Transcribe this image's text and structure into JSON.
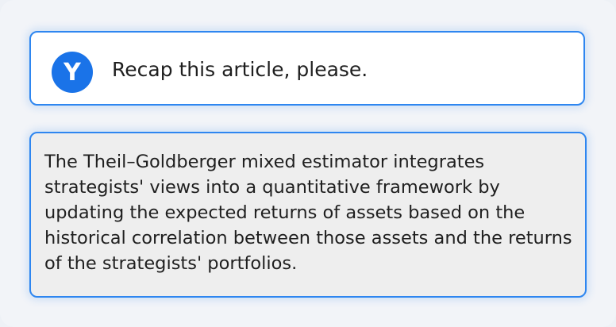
{
  "user_message": {
    "avatar_letter": "Y",
    "text": "Recap this article, please."
  },
  "assistant_message": {
    "text": "The Theil–Goldberger mixed estimator integrates strategists' views into a quantitative framework by updating the expected returns of assets based on the historical correlation between those assets and the returns of the strategists' portfolios."
  },
  "colors": {
    "accent": "#2e86f0",
    "avatar_bg": "#1a73e8",
    "reply_bg": "#eeeeee"
  }
}
